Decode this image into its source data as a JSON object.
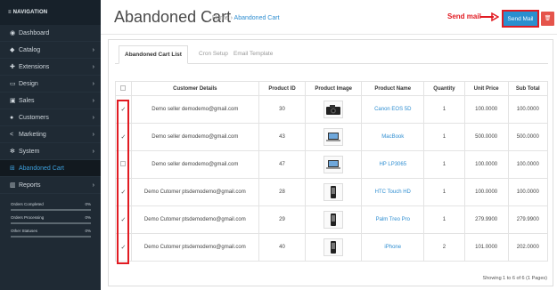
{
  "sidebar": {
    "header": "≡ NAVIGATION",
    "items": [
      {
        "label": "Dashboard",
        "icon": "dashboard-icon",
        "glyph": "◉",
        "chevron": false
      },
      {
        "label": "Catalog",
        "icon": "tag-icon",
        "glyph": "◆",
        "chevron": true
      },
      {
        "label": "Extensions",
        "icon": "puzzle-icon",
        "glyph": "✚",
        "chevron": true
      },
      {
        "label": "Design",
        "icon": "monitor-icon",
        "glyph": "▭",
        "chevron": true
      },
      {
        "label": "Sales",
        "icon": "cart-icon",
        "glyph": "▣",
        "chevron": true
      },
      {
        "label": "Customers",
        "icon": "user-icon",
        "glyph": "●",
        "chevron": true
      },
      {
        "label": "Marketing",
        "icon": "share-icon",
        "glyph": "<",
        "chevron": true
      },
      {
        "label": "System",
        "icon": "gear-icon",
        "glyph": "✻",
        "chevron": true
      },
      {
        "label": "Abandoned Cart",
        "icon": "cart-icon",
        "glyph": "⊞",
        "chevron": false,
        "active": true
      },
      {
        "label": "Reports",
        "icon": "bar-chart-icon",
        "glyph": "▥",
        "chevron": true
      }
    ],
    "stats": [
      {
        "label": "Orders Completed",
        "value": "0%"
      },
      {
        "label": "Orders Processing",
        "value": "0%"
      },
      {
        "label": "Other Statuses",
        "value": "0%"
      }
    ]
  },
  "header": {
    "title": "Abandoned Cart",
    "breadcrumb_home": "Home",
    "breadcrumb_sep": "›",
    "breadcrumb_current": "Abandoned Cart",
    "annotation": "Send mail",
    "send_button": "Send Mail",
    "delete_glyph": "🗑"
  },
  "tabs": [
    "Abandoned Cart List",
    "Cron Setup",
    "Email Template"
  ],
  "table": {
    "headers": [
      "",
      "Customer Details",
      "Product ID",
      "Product Image",
      "Product Name",
      "Quantity",
      "Unit Price",
      "Sub Total"
    ],
    "rows": [
      {
        "checked": true,
        "customer": "Demo seller demodemo@gmail.com",
        "product_id": "30",
        "image": "camera-icon",
        "product_name": "Canon EOS 5D",
        "quantity": "1",
        "unit_price": "100.0000",
        "sub_total": "100.0000"
      },
      {
        "checked": true,
        "customer": "Demo seller demodemo@gmail.com",
        "product_id": "43",
        "image": "laptop-icon",
        "product_name": "MacBook",
        "quantity": "1",
        "unit_price": "500.0000",
        "sub_total": "500.0000"
      },
      {
        "checked": false,
        "customer": "Demo seller demodemo@gmail.com",
        "product_id": "47",
        "image": "laptop-icon",
        "product_name": "HP LP3065",
        "quantity": "1",
        "unit_price": "100.0000",
        "sub_total": "100.0000"
      },
      {
        "checked": true,
        "customer": "Demo Cutomer ptsdemodemo@gmail.com",
        "product_id": "28",
        "image": "phone-icon",
        "product_name": "HTC Touch HD",
        "quantity": "1",
        "unit_price": "100.0000",
        "sub_total": "100.0000"
      },
      {
        "checked": true,
        "customer": "Demo Cutomer ptsdemodemo@gmail.com",
        "product_id": "29",
        "image": "phone-icon",
        "product_name": "Palm Treo Pro",
        "quantity": "1",
        "unit_price": "279.9900",
        "sub_total": "279.9900"
      },
      {
        "checked": true,
        "customer": "Demo Cutomer ptsdemodemo@gmail.com",
        "product_id": "40",
        "image": "phone-icon",
        "product_name": "iPhone",
        "quantity": "2",
        "unit_price": "101.0000",
        "sub_total": "202.0000"
      }
    ],
    "footer": "Showing 1 to 6 of 6 (1 Pages)"
  },
  "colors": {
    "accent": "#2a8fcf",
    "highlight": "#e11b22",
    "sidebar": "#1f2a34",
    "danger": "#e5544b"
  }
}
